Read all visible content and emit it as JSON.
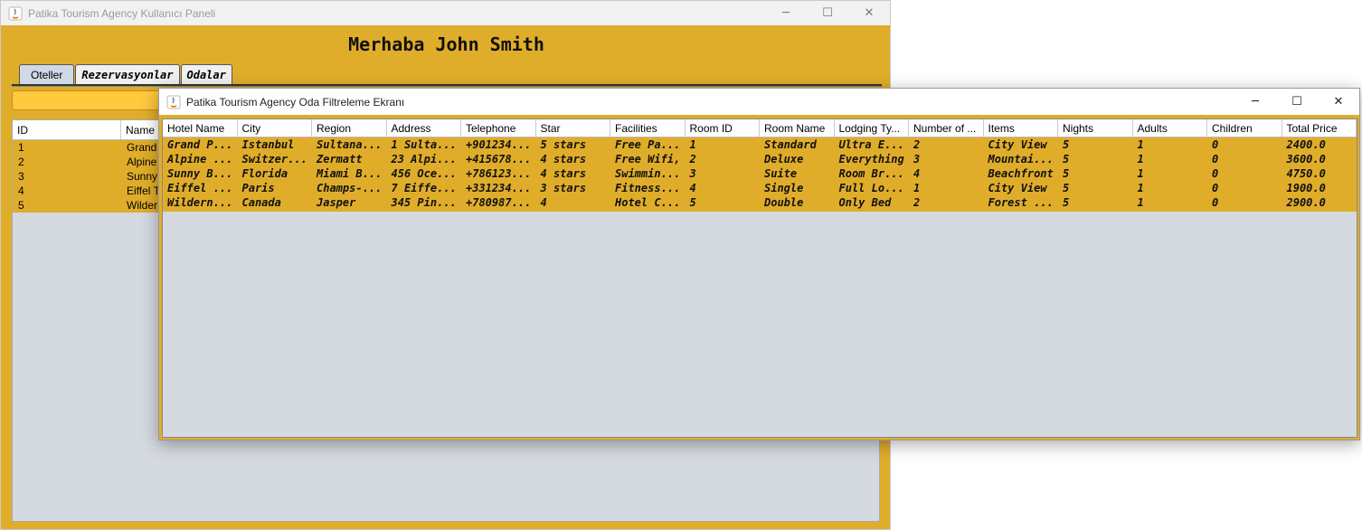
{
  "main_window": {
    "title": "Patika Tourism Agency Kullanıcı Paneli",
    "greeting": "Merhaba John Smith",
    "tabs": [
      "Oteller",
      "Rezervasyonlar",
      "Odalar"
    ],
    "table": {
      "columns": [
        "ID",
        "Name"
      ],
      "rows": [
        [
          "1",
          "Grand"
        ],
        [
          "2",
          "Alpine"
        ],
        [
          "3",
          "Sunny"
        ],
        [
          "4",
          "Eiffel T"
        ],
        [
          "5",
          "Wilder"
        ]
      ]
    }
  },
  "filter_window": {
    "title": "Patika Tourism Agency Oda Filtreleme Ekranı",
    "table": {
      "columns": [
        "Hotel Name",
        "City",
        "Region",
        "Address",
        "Telephone",
        "Star",
        "Facilities",
        "Room ID",
        "Room Name",
        "Lodging Ty...",
        "Number of ...",
        "Items",
        "Nights",
        "Adults",
        "Children",
        "Total Price"
      ],
      "rows": [
        [
          "Grand P...",
          "Istanbul",
          "Sultana...",
          "1 Sulta...",
          "+901234...",
          "5 stars",
          "Free Pa...",
          "1",
          "Standard",
          "Ultra E...",
          "2",
          "City View",
          "5",
          "1",
          "0",
          "2400.0"
        ],
        [
          "Alpine ...",
          "Switzer...",
          "Zermatt",
          "23 Alpi...",
          "+415678...",
          "4 stars",
          "Free Wifi,",
          "2",
          "Deluxe",
          "Everything",
          "3",
          "Mountai...",
          "5",
          "1",
          "0",
          "3600.0"
        ],
        [
          "Sunny B...",
          "Florida",
          "Miami B...",
          "456 Oce...",
          "+786123...",
          "4 stars",
          "Swimmin...",
          "3",
          "Suite",
          "Room Br...",
          "4",
          "Beachfront",
          "5",
          "1",
          "0",
          "4750.0"
        ],
        [
          "Eiffel ...",
          "Paris",
          "Champs-...",
          "7 Eiffe...",
          "+331234...",
          "3 stars",
          "Fitness...",
          "4",
          "Single",
          "Full Lo...",
          "1",
          "City View",
          "5",
          "1",
          "0",
          "1900.0"
        ],
        [
          "Wildern...",
          "Canada",
          "Jasper",
          "345 Pin...",
          "+780987...",
          "4",
          "Hotel C...",
          "5",
          "Double",
          "Only Bed",
          "2",
          "Forest ...",
          "5",
          "1",
          "0",
          "2900.0"
        ]
      ]
    }
  },
  "window_controls": {
    "minimize": "─",
    "maximize": "☐",
    "close": "✕"
  },
  "colors": {
    "accent": "#e0ad2b",
    "table_bg": "#d5d9e0",
    "selected_tab": "#cfdae6"
  }
}
